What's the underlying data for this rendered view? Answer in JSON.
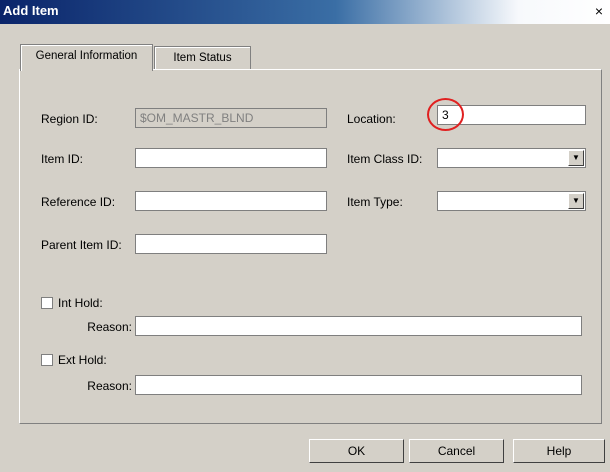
{
  "window": {
    "title": "Add Item",
    "close_icon": "×"
  },
  "tabs": [
    {
      "label": "General Information",
      "active": true
    },
    {
      "label": "Item Status",
      "active": false
    }
  ],
  "form": {
    "region_id": {
      "label": "Region ID:",
      "value": "$OM_MASTR_BLND",
      "disabled": true
    },
    "location": {
      "label": "Location:",
      "value": "3"
    },
    "item_id": {
      "label": "Item ID:",
      "value": ""
    },
    "item_class_id": {
      "label": "Item Class ID:",
      "value": ""
    },
    "reference_id": {
      "label": "Reference ID:",
      "value": ""
    },
    "item_type": {
      "label": "Item Type:",
      "value": ""
    },
    "parent_item_id": {
      "label": "Parent Item ID:",
      "value": ""
    },
    "int_hold": {
      "label": "Int Hold:",
      "checked": false,
      "reason_label": "Reason:",
      "reason_value": ""
    },
    "ext_hold": {
      "label": "Ext Hold:",
      "checked": false,
      "reason_label": "Reason:",
      "reason_value": ""
    }
  },
  "annotation": {
    "highlight_color": "#e02020"
  },
  "buttons": {
    "ok": "OK",
    "cancel": "Cancel",
    "help": "Help"
  },
  "colors": {
    "titlebar_start": "#0a246a",
    "face": "#d4d0c8"
  }
}
